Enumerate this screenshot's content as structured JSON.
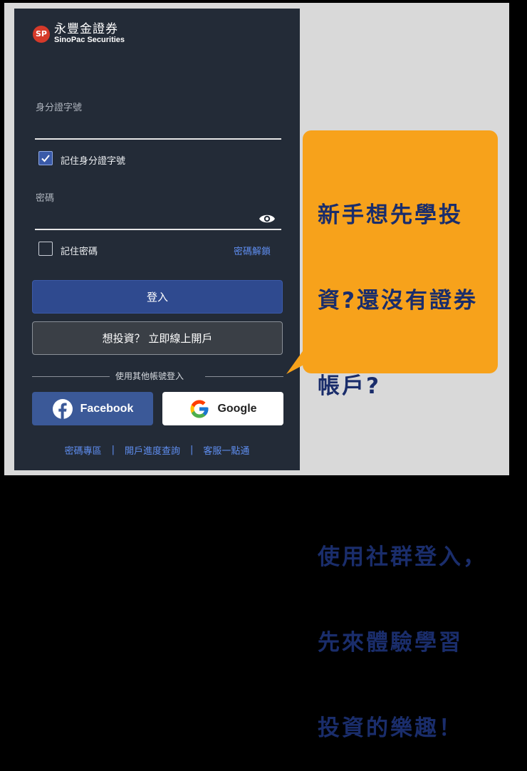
{
  "brand": {
    "name_cn": "永豐金證券",
    "name_en": "SinoPac Securities"
  },
  "form": {
    "id_label": "身分證字號",
    "remember_id_label": "記住身分證字號",
    "password_label": "密碼",
    "remember_password_label": "記住密碼",
    "unlock_link": "密碼解鎖",
    "login_button": "登入",
    "open_account_button": "想投資？ 立即線上開戶",
    "other_login_label": "使用其他帳號登入",
    "facebook_button": "Facebook",
    "google_button": "Google",
    "remember_id_checked": true,
    "remember_password_checked": false
  },
  "footer": {
    "links": [
      "密碼專區",
      "開戶進度查詢",
      "客服一點通"
    ],
    "separator": "|"
  },
  "callout": {
    "lines": [
      "新手想先學投",
      "資?還沒有證券",
      "帳戶?",
      "",
      "使用社群登入，",
      "先來體驗學習",
      "投資的樂趣！"
    ]
  },
  "colors": {
    "panel_bg": "#232b37",
    "primary": "#2f4a8f",
    "facebook": "#3b5998",
    "link": "#5f8ef0",
    "callout_bg": "#f7a21b",
    "callout_text": "#1a2d6b"
  },
  "icons": {
    "show_password": "eye-icon",
    "checkbox": "check-icon",
    "facebook": "facebook-logo-icon",
    "google": "google-logo-icon"
  }
}
